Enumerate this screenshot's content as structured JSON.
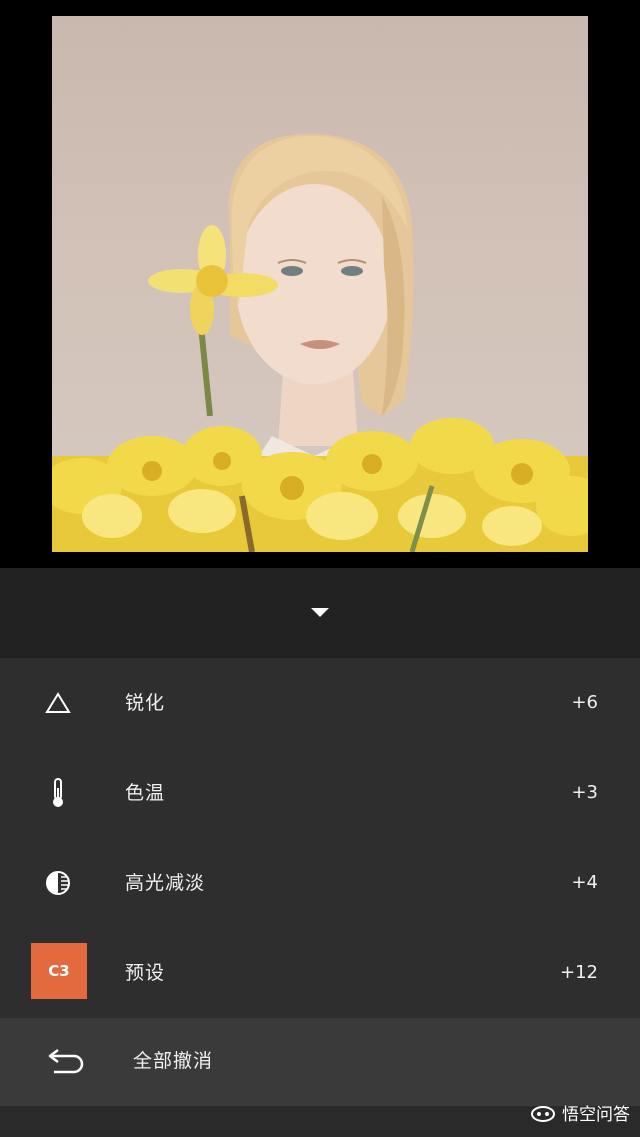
{
  "adjustments": [
    {
      "label": "锐化",
      "value": "+6",
      "icon": "sharpen-triangle-icon"
    },
    {
      "label": "色温",
      "value": "+3",
      "icon": "thermometer-icon"
    },
    {
      "label": "高光减淡",
      "value": "+4",
      "icon": "highlights-half-circle-icon"
    },
    {
      "label": "预设",
      "value": "+12",
      "icon": "preset-badge"
    }
  ],
  "preset_badge": "C3",
  "undo_all_label": "全部撤消",
  "watermark": "悟空问答",
  "colors": {
    "preset_accent": "#e36a3e",
    "panel_bg": "#2e2e2e",
    "undo_bg": "#3a3a3a"
  }
}
